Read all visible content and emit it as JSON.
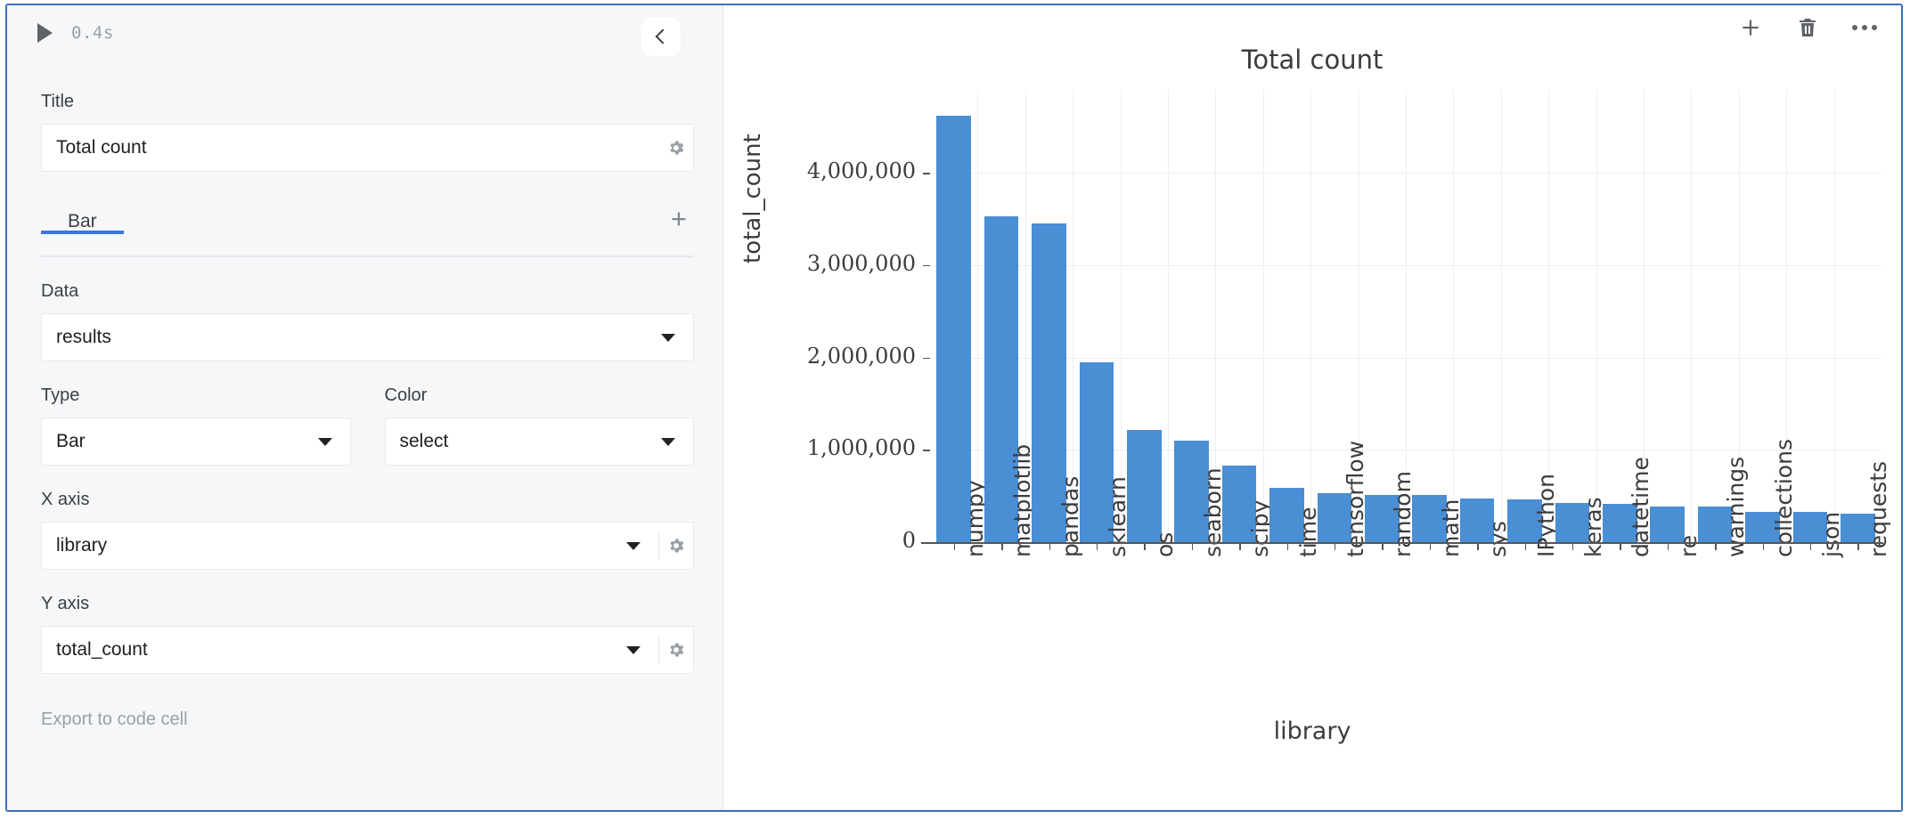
{
  "cell": {
    "run_icon": "play-icon",
    "runtime": "0.4s",
    "collapse_icon": "chevron-left-icon"
  },
  "toolbar": {
    "add_icon": "plus-icon",
    "delete_icon": "trash-icon",
    "more_icon": "ellipsis-icon"
  },
  "panel": {
    "title_label": "Title",
    "title_value": "Total count",
    "title_gear_icon": "gear-icon",
    "tabs": [
      {
        "label": "Bar",
        "active": true
      }
    ],
    "add_tab_icon": "plus-icon",
    "data_label": "Data",
    "data_value": "results",
    "type_label": "Type",
    "type_value": "Bar",
    "color_label": "Color",
    "color_value": "select",
    "x_axis_label": "X axis",
    "x_axis_value": "library",
    "x_axis_gear_icon": "gear-icon",
    "y_axis_label": "Y axis",
    "y_axis_value": "total_count",
    "y_axis_gear_icon": "gear-icon",
    "export_label": "Export to code cell",
    "accent_color": "#3b78d8"
  },
  "chart_data": {
    "type": "bar",
    "title": "Total count",
    "xlabel": "library",
    "ylabel": "total_count",
    "bar_color": "#4a8ed4",
    "grid": true,
    "legend": false,
    "ylim": [
      0,
      4900000
    ],
    "ytick_labels": [
      "0",
      "1,000,000",
      "2,000,000",
      "3,000,000",
      "4,000,000"
    ],
    "ytick_values": [
      0,
      1000000,
      2000000,
      3000000,
      4000000
    ],
    "categories": [
      "numpy",
      "matplotlib",
      "pandas",
      "sklearn",
      "os",
      "seaborn",
      "scipy",
      "time",
      "tensorflow",
      "random",
      "math",
      "sys",
      "IPython",
      "keras",
      "datetime",
      "re",
      "warnings",
      "collections",
      "json",
      "requests"
    ],
    "values": [
      4620000,
      3530000,
      3450000,
      1950000,
      1220000,
      1100000,
      830000,
      590000,
      530000,
      510000,
      510000,
      470000,
      460000,
      420000,
      410000,
      390000,
      390000,
      330000,
      325000,
      310000
    ]
  }
}
